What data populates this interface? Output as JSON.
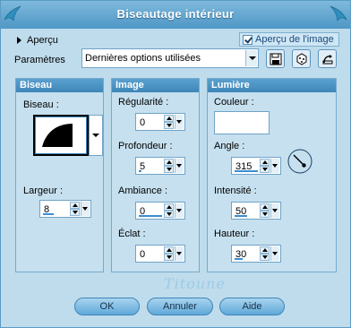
{
  "window": {
    "title": "Biseautage intérieur"
  },
  "top": {
    "apercu_label": "Aperçu",
    "apercu_image_label": "Aperçu de l'image",
    "apercu_image_checked": true,
    "params_label": "Paramètres",
    "params_value": "Dernières options utilisées"
  },
  "groups": {
    "biseau": {
      "header": "Biseau",
      "biseau_label": "Biseau :",
      "largeur_label": "Largeur :",
      "largeur_value": "8"
    },
    "image": {
      "header": "Image",
      "regularite_label": "Régularité :",
      "regularite_value": "0",
      "profondeur_label": "Profondeur :",
      "profondeur_value": "5",
      "ambiance_label": "Ambiance :",
      "ambiance_value": "0",
      "eclat_label": "Éclat :",
      "eclat_value": "0"
    },
    "lumiere": {
      "header": "Lumière",
      "couleur_label": "Couleur :",
      "couleur_value": "#ffffff",
      "angle_label": "Angle :",
      "angle_value": "315",
      "intensite_label": "Intensité :",
      "intensite_value": "50",
      "hauteur_label": "Hauteur :",
      "hauteur_value": "30"
    }
  },
  "signature": "Titoune",
  "buttons": {
    "ok": "OK",
    "cancel": "Annuler",
    "help": "Aide"
  },
  "colors": {
    "titlebar": "#4e97c6",
    "dialog_bg": "#bfdcec",
    "group_header": "#3d86b8"
  },
  "icons": {
    "left_corner": "bird-logo-icon",
    "right_corner": "bird-logo-icon",
    "tool_1": "save-preset-icon",
    "tool_2": "randomize-dice-icon",
    "tool_3": "reset-icon"
  }
}
